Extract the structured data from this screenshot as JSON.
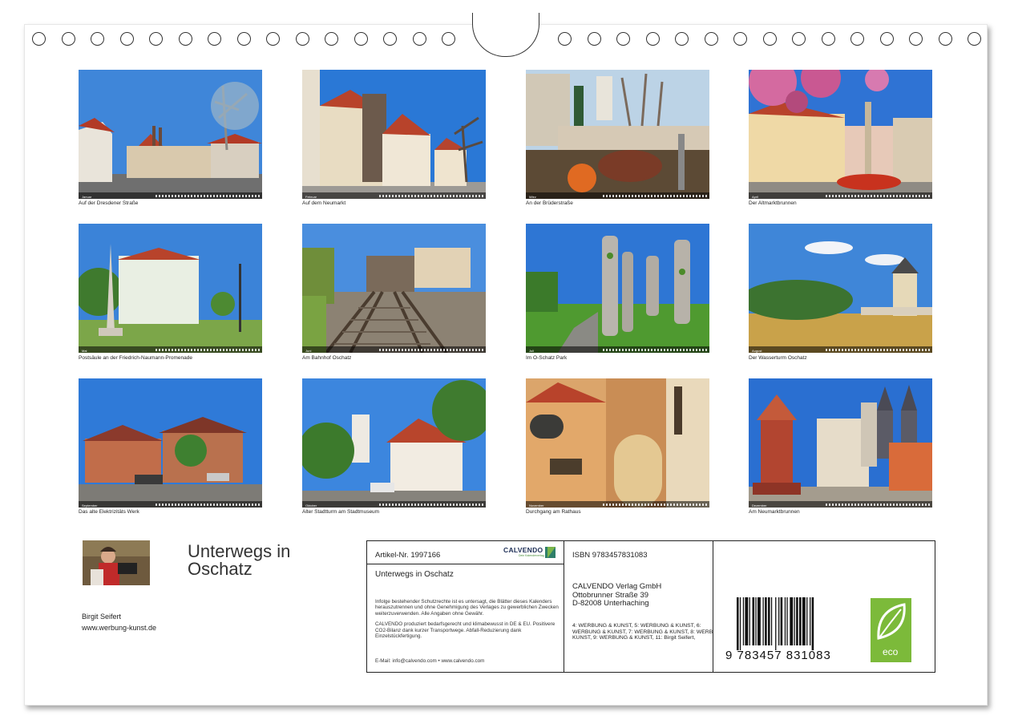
{
  "months": [
    "Januar",
    "Februar",
    "März",
    "April",
    "Mai",
    "Juni",
    "Juli",
    "August",
    "September",
    "Oktober",
    "November",
    "Dezember"
  ],
  "captions": [
    "Auf der Dresdener Straße",
    "Auf dem Neumarkt",
    "An der Brüderstraße",
    "Der Altmarktbrunnen",
    "Postsäule an der Friedrich-Naumann-Promenade",
    "Am Bahnhof Oschatz",
    "Im O-Schatz Park",
    "Der Wasserturm Oschatz",
    "Das alte Elektrizitäts Werk",
    "Alter Stadtturm am Stadtmuseum",
    "Durchgang am Rathaus",
    "Am Neumarktbrunnen"
  ],
  "title": {
    "line1": "Unterwegs in",
    "line2": "Oschatz"
  },
  "author": {
    "name": "Birgit Seifert",
    "website": "www.werbung-kunst.de"
  },
  "info": {
    "artikel": "Artikel-Nr. 1997166",
    "brand": "CALVENDO",
    "brand_sub": "Dein Kalenderverlag",
    "book_title": "Unterwegs in Oschatz",
    "legal1": "Infolge bestehender Schutzrechte ist es untersagt, die Blätter dieses Kalenders herauszutrennen und ohne Genehmigung des Verlages zu gewerblichen Zwecken weiterzuverwenden. Alle Angaben ohne Gewähr.",
    "legal2": "CALVENDO produziert bedarfsgerecht und klimabewusst in DE & EU. Positivere CO2-Bilanz dank kurzer Transportwege. Abfall-Reduzierung dank Einzelstückfertigung.",
    "email": "E-Mail: info@calvendo.com • www.calvendo.com",
    "isbn": "ISBN 9783457831083",
    "publisher": [
      "CALVENDO Verlag GmbH",
      "Ottobrunner Straße 39",
      "D-82008 Unterhaching"
    ],
    "credits": [
      "4: WERBUNG & KUNST, 5: WERBUNG & KUNST, 6:",
      "WERBUNG & KUNST, 7: WERBUNG & KUNST, 8: WERBUNG &",
      "KUNST, 9: WERBUNG & KUNST, 11: Birgit Seifert,"
    ],
    "barcode_number": "9 783457 831083",
    "eco_label": "eco"
  },
  "colors": {
    "sky": "#3d82d8",
    "grass": "#5fa23a",
    "roof": "#c0402a",
    "eco": "#7cba3a"
  }
}
